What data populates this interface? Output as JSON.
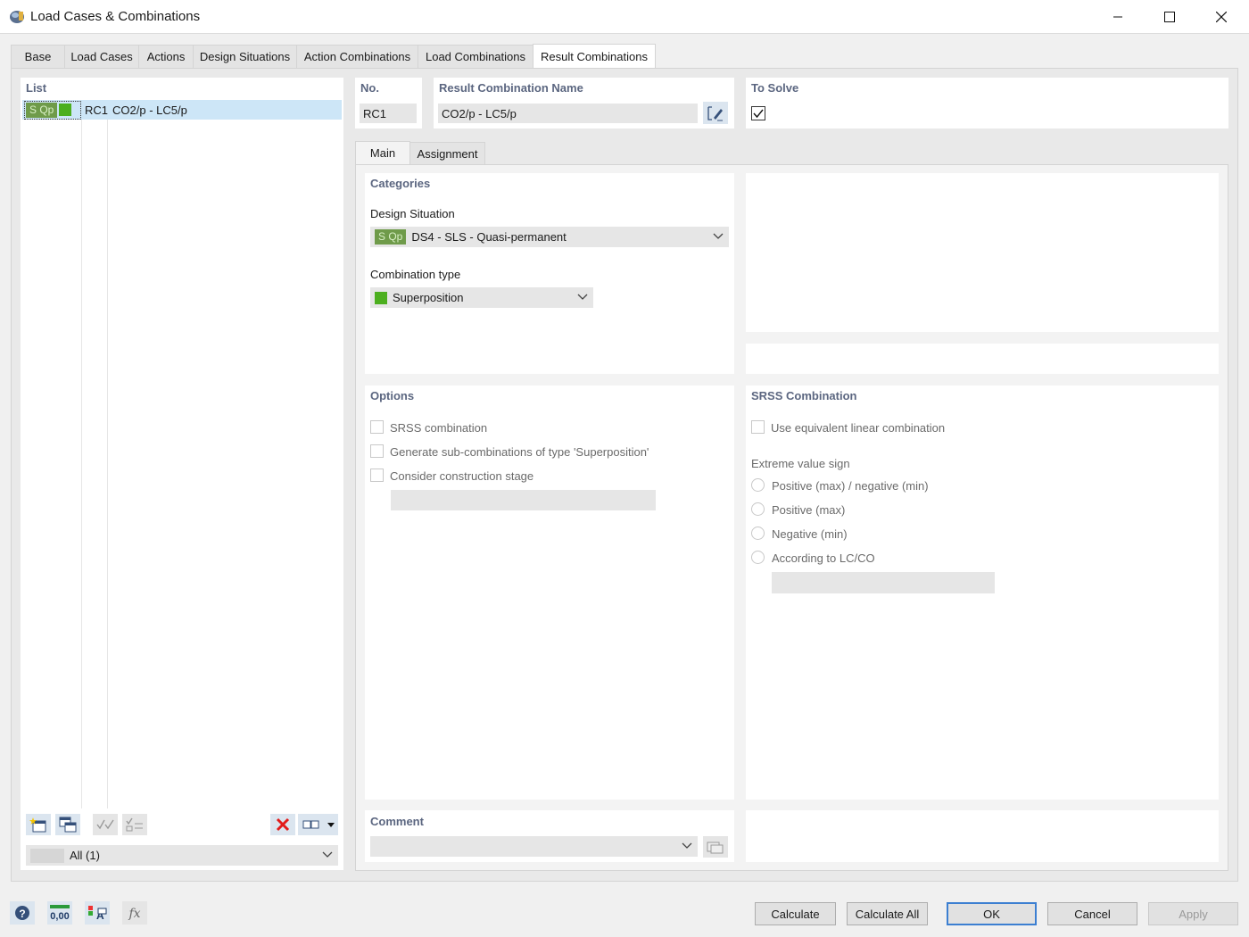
{
  "window": {
    "title": "Load Cases & Combinations"
  },
  "tabs": [
    "Base",
    "Load Cases",
    "Actions",
    "Design Situations",
    "Action Combinations",
    "Load Combinations",
    "Result Combinations"
  ],
  "active_tab": "Result Combinations",
  "list": {
    "header": "List",
    "items": [
      {
        "badge": "S Qp",
        "id": "RC1",
        "name": "CO2/p - LC5/p",
        "color": "#4caf1f"
      }
    ],
    "filter": {
      "value": "All (1)"
    }
  },
  "no": {
    "label": "No.",
    "value": "RC1"
  },
  "name": {
    "label": "Result Combination Name",
    "value": "CO2/p - LC5/p"
  },
  "to_solve": {
    "label": "To Solve",
    "checked": true
  },
  "subtabs": [
    "Main",
    "Assignment"
  ],
  "categories": {
    "header": "Categories",
    "design_situation_label": "Design Situation",
    "design_situation": {
      "badge": "S Qp",
      "value": "DS4 - SLS - Quasi-permanent"
    },
    "combination_type_label": "Combination type",
    "combination_type": {
      "value": "Superposition",
      "color": "#4caf1f"
    }
  },
  "options": {
    "header": "Options",
    "items": [
      "SRSS combination",
      "Generate sub-combinations of type 'Superposition'",
      "Consider construction stage"
    ]
  },
  "srss": {
    "header": "SRSS Combination",
    "use_equivalent": "Use equivalent linear combination",
    "extreme_label": "Extreme value sign",
    "radios": [
      "Positive (max) / negative (min)",
      "Positive (max)",
      "Negative (min)",
      "According to LC/CO"
    ]
  },
  "comment": {
    "header": "Comment"
  },
  "buttons": {
    "calculate": "Calculate",
    "calculate_all": "Calculate All",
    "ok": "OK",
    "cancel": "Cancel",
    "apply": "Apply"
  },
  "colors": {
    "accent": "#3c7fd1",
    "selection": "#cde6f7",
    "badge": "#6f9b4a",
    "header_text": "#5b6680"
  },
  "footer_icons": [
    "help-icon",
    "units-icon",
    "display-properties-icon",
    "function-icon"
  ]
}
